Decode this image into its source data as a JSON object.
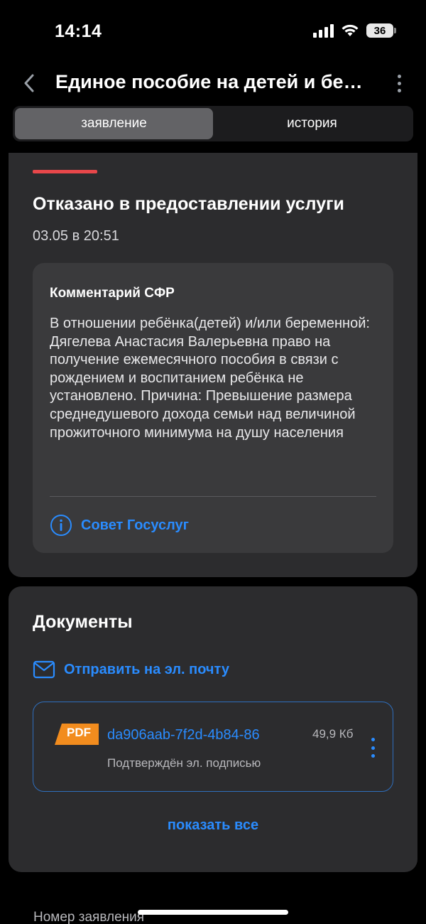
{
  "status_bar": {
    "time": "14:14",
    "battery": "36"
  },
  "header": {
    "title": "Единое пособие на детей и беременных женщин"
  },
  "tabs": [
    {
      "label": "заявление",
      "active": true
    },
    {
      "label": "история",
      "active": false
    }
  ],
  "status_card": {
    "title": "Отказано в предоставлении услуги",
    "date": "03.05 в 20:51",
    "accent_color": "#e8474a",
    "comment": {
      "title": "Комментарий СФР",
      "text": "В отношении ребёнка(детей) и/или беременной: Дягелева Анастасия Валерьевна право на получение ежемесячного пособия в связи с рождением и воспитанием ребёнка не установлено. Причина: Превышение размера среднедушевого дохода семьи над величиной прожиточного минимума на душу населения",
      "tip_label": "Совет Госуслуг",
      "tip_icon": "info-icon"
    }
  },
  "documents": {
    "title": "Документы",
    "email_label": "Отправить на эл. почту",
    "email_icon": "mail-icon",
    "file": {
      "badge": "PDF",
      "name": "da906aab-7f2d-4b84-86",
      "size": "49,9 Кб",
      "signed": "Подтверждён эл. подписью"
    },
    "show_all": "показать все"
  },
  "footer": {
    "app_number_label": "Номер заявления"
  },
  "colors": {
    "link": "#2a8cff",
    "card_bg": "#2c2c2e",
    "inner_bg": "#3a3a3c"
  }
}
